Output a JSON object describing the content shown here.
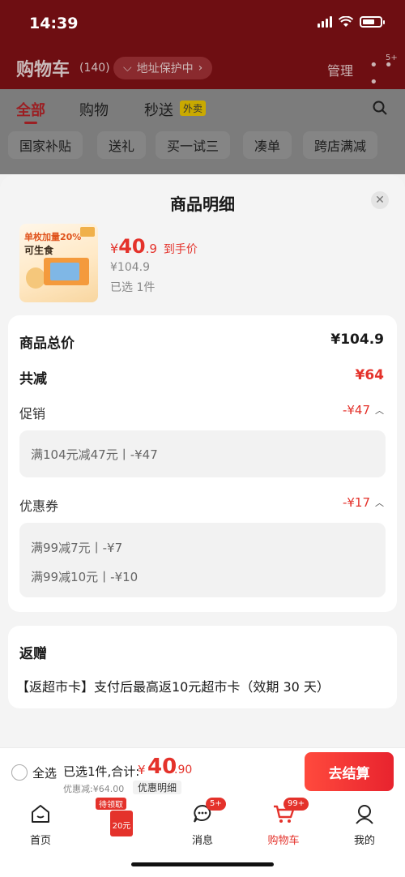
{
  "status_bar": {
    "time": "14:39"
  },
  "header": {
    "title": "购物车",
    "count": "(140)",
    "address_pill": "地址保护中",
    "manage": "管理",
    "more_badge": "5+"
  },
  "tabs": [
    {
      "label": "全部",
      "active": true
    },
    {
      "label": "购物"
    },
    {
      "label": "秒送",
      "tag": "外卖"
    }
  ],
  "chips": [
    "国家补贴",
    "送礼",
    "买一试三",
    "凑单",
    "跨店满减"
  ],
  "sheet": {
    "title": "商品明细",
    "product": {
      "image_text_line1": "单枚加量20%",
      "image_text_line2": "可生食",
      "price_symbol": "¥",
      "price_int": "40",
      "price_dec": ".9",
      "price_tag": "到手价",
      "original_price": "¥104.9",
      "selected": "已选 1件"
    },
    "summary": {
      "total_label": "商品总价",
      "total_value": "¥104.9",
      "reduce_label": "共减",
      "reduce_value": "¥64",
      "promo_label": "促销",
      "promo_value": "-¥47",
      "promo_details": [
        "满104元减47元丨-¥47"
      ],
      "coupon_label": "优惠券",
      "coupon_value": "-¥17",
      "coupon_details": [
        "满99减7元丨-¥7",
        "满99减10元丨-¥10"
      ]
    },
    "gift": {
      "title": "返赠",
      "text": "【返超市卡】支付后最高返10元超市卡（效期 30 天）"
    }
  },
  "checkout": {
    "select_all": "全选",
    "total_label": "已选1件,合计:",
    "total_symbol": "¥",
    "total_int": "40",
    "total_dec": ".90",
    "discount": "优惠减:¥64.00",
    "detail_link": "优惠明细",
    "button": "去结算"
  },
  "nav": {
    "items": [
      {
        "label": "首页",
        "icon": "home-icon"
      },
      {
        "label": "",
        "icon": "coupon-icon",
        "tag": "待领取",
        "coupon_text": "20元"
      },
      {
        "label": "消息",
        "icon": "message-icon",
        "badge": "5+"
      },
      {
        "label": "购物车",
        "icon": "cart-icon",
        "badge": "99+",
        "active": true
      },
      {
        "label": "我的",
        "icon": "profile-icon"
      }
    ]
  },
  "colors": {
    "accent": "#e4322b",
    "header_bg": "#6e0e12"
  }
}
